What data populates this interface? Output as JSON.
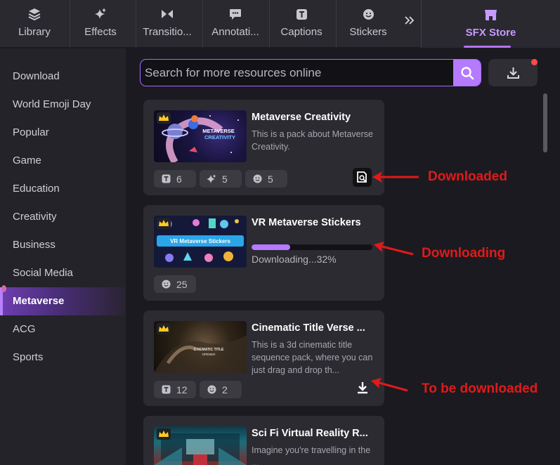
{
  "tabs": [
    {
      "label": "Library",
      "icon": "layers-icon"
    },
    {
      "label": "Effects",
      "icon": "sparkle-icon"
    },
    {
      "label": "Transitio...",
      "icon": "bowtie-icon"
    },
    {
      "label": "Annotati...",
      "icon": "speech-bubble-icon"
    },
    {
      "label": "Captions",
      "icon": "text-box-icon"
    },
    {
      "label": "Stickers",
      "icon": "smiley-icon"
    }
  ],
  "store_tab": {
    "label": "SFX Store",
    "icon": "store-icon",
    "accent": "#b473ff"
  },
  "sidebar": {
    "items": [
      {
        "label": "Download"
      },
      {
        "label": "World Emoji Day"
      },
      {
        "label": "Popular"
      },
      {
        "label": "Game"
      },
      {
        "label": "Education"
      },
      {
        "label": "Creativity"
      },
      {
        "label": "Business"
      },
      {
        "label": "Social Media"
      },
      {
        "label": "Metaverse",
        "active": true
      },
      {
        "label": "ACG"
      },
      {
        "label": "Sports"
      }
    ]
  },
  "search": {
    "placeholder": "Search for more resources online"
  },
  "cards": [
    {
      "title": "Metaverse Creativity",
      "description": "This is a pack about Metaverse Creativity.",
      "thumb_text_1": "METAVERSE",
      "thumb_text_2": "CREATIVITY",
      "chips": [
        {
          "icon": "text-box-icon",
          "count": "6"
        },
        {
          "icon": "sparkle-icon",
          "count": "5"
        },
        {
          "icon": "smiley-icon",
          "count": "5"
        }
      ],
      "status": "downloaded"
    },
    {
      "title": "VR Metaverse Stickers",
      "thumb_text_1": "VR Metaverse Stickers",
      "progress": 0.32,
      "status_text": "Downloading...32%",
      "chips": [
        {
          "icon": "smiley-icon",
          "count": "25"
        }
      ],
      "status": "downloading"
    },
    {
      "title": "Cinematic Title Verse ...",
      "description": "This is a 3d cinematic title sequence pack, where you can just drag and drop th...",
      "thumb_text_1": "CINEMATIC TITLE",
      "thumb_text_2": "OPENER",
      "chips": [
        {
          "icon": "text-box-icon",
          "count": "12"
        },
        {
          "icon": "smiley-icon",
          "count": "2"
        }
      ],
      "status": "to-download"
    },
    {
      "title": "Sci Fi Virtual Reality R...",
      "description": "Imagine you're travelling in the ...",
      "status": "unknown"
    }
  ],
  "annotations": {
    "downloaded": "Downloaded",
    "downloading": "Downloading",
    "to_download": "To be downloaded",
    "color": "#e01a1a"
  }
}
